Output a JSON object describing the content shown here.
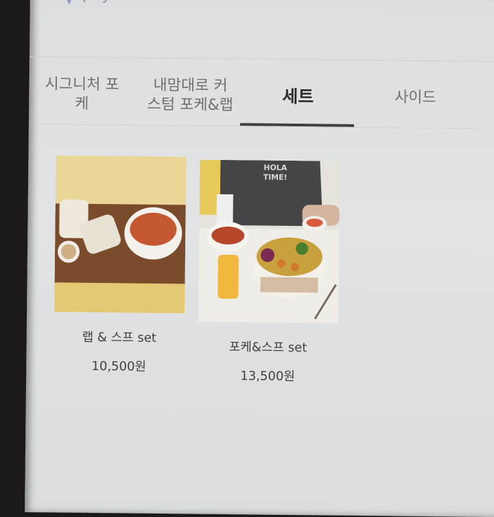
{
  "brand": {
    "name": "payhere"
  },
  "tabs": [
    {
      "label": "시그니처 포\n케",
      "active": false
    },
    {
      "label": "내맘대로 커\n스텀 포케&랩",
      "active": false
    },
    {
      "label": "세트",
      "active": true
    },
    {
      "label": "사이드",
      "active": false
    }
  ],
  "products": [
    {
      "name": "랩 & 스프 set",
      "price": "10,500원",
      "image_icon": "wrap-soup-photo"
    },
    {
      "name": "포케&스프 set",
      "price": "13,500원",
      "image_icon": "poke-soup-photo",
      "photo_text": "HOLA\nTIME!"
    }
  ],
  "colors": {
    "active_tab": "#2c2d2e",
    "inactive_tab": "#6d6f70",
    "underline": "#3d3f40"
  }
}
